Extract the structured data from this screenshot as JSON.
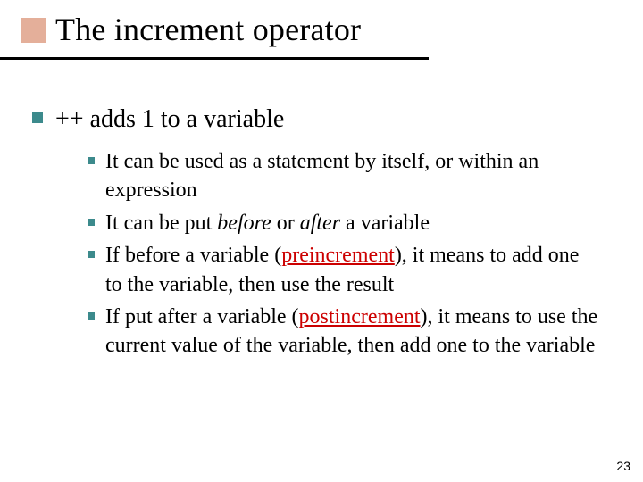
{
  "slide": {
    "title": "The increment operator",
    "main_bullet": "++ adds 1 to a variable",
    "sub_bullets": [
      {
        "prefix": "It can be used as a statement by itself, or within an expression"
      },
      {
        "prefix": "It can be put ",
        "em1": "before",
        "mid": " or ",
        "em2": "after",
        "suffix": " a variable"
      },
      {
        "prefix": "If before a variable (",
        "red": "preincrement",
        "suffix": "), it means to add one to the variable, then use the result"
      },
      {
        "prefix": "If put after a variable (",
        "red": "postincrement",
        "suffix": "), it means to use the current value of the variable, then add one to the variable"
      }
    ],
    "page_number": "23"
  }
}
